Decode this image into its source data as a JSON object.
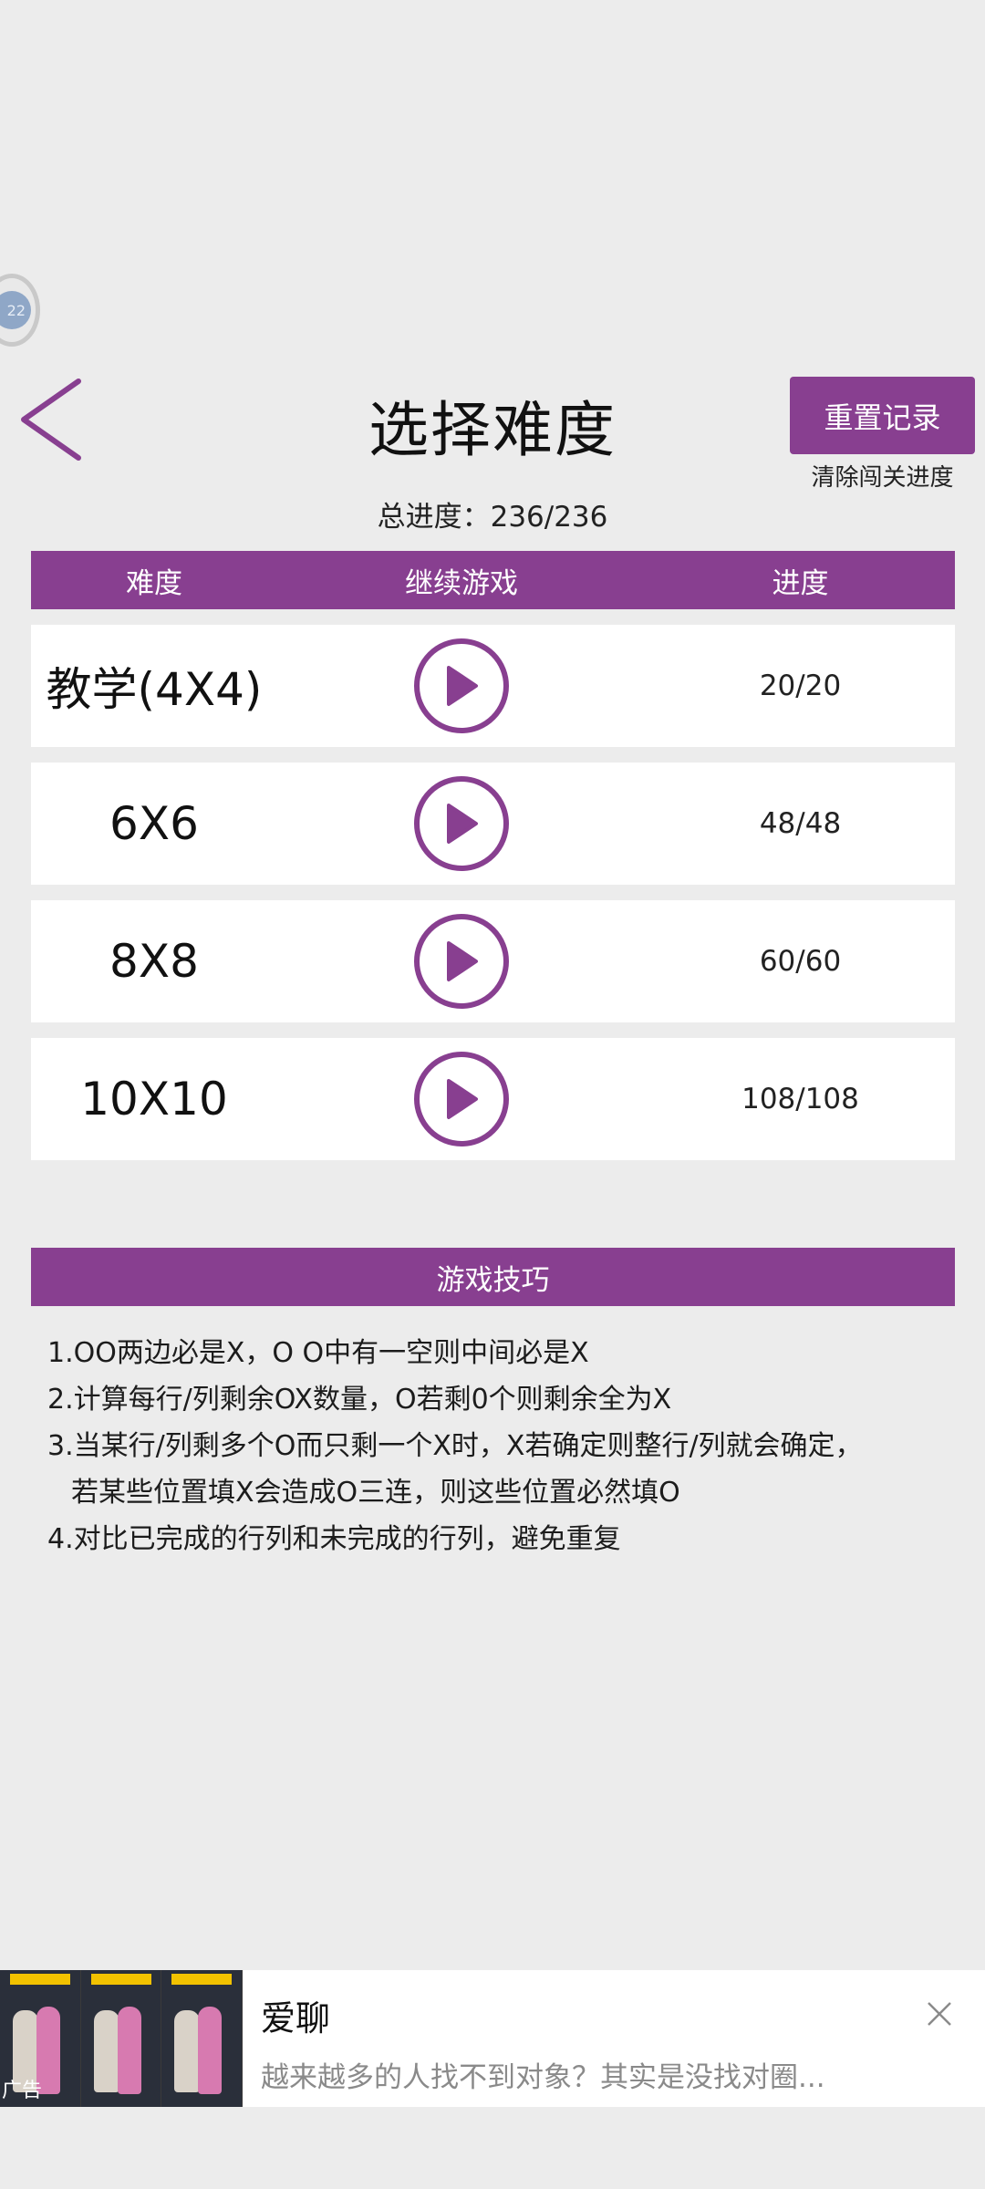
{
  "float_ball": {
    "label": "22"
  },
  "header": {
    "title": "选择难度",
    "reset_label": "重置记录",
    "reset_sub": "清除闯关进度",
    "total_progress": "总进度：236/236"
  },
  "table": {
    "headers": [
      "难度",
      "继续游戏",
      "进度"
    ],
    "rows": [
      {
        "difficulty": "教学(4X4)",
        "progress": "20/20"
      },
      {
        "difficulty": "6X6",
        "progress": "48/48"
      },
      {
        "difficulty": "8X8",
        "progress": "60/60"
      },
      {
        "difficulty": "10X10",
        "progress": "108/108"
      }
    ]
  },
  "tips": {
    "title": "游戏技巧",
    "lines": [
      "1.OO两边必是X，O O中有一空则中间必是X",
      "2.计算每行/列剩余OX数量，O若剩0个则剩余全为X",
      "3.当某行/列剩多个O而只剩一个X时，X若确定则整行/列就会确定，",
      "若某些位置填X会造成O三连，则这些位置必然填O",
      "4.对比已完成的行列和未完成的行列，避免重复"
    ]
  },
  "ad": {
    "label": "广告",
    "title": "爱聊",
    "description": "越来越多的人找不到对象？其实是没找对圈..."
  },
  "colors": {
    "accent": "#883f90",
    "background": "#ececec"
  },
  "icons": {
    "back": "chevron-left-icon",
    "play": "play-icon",
    "close": "close-icon"
  }
}
